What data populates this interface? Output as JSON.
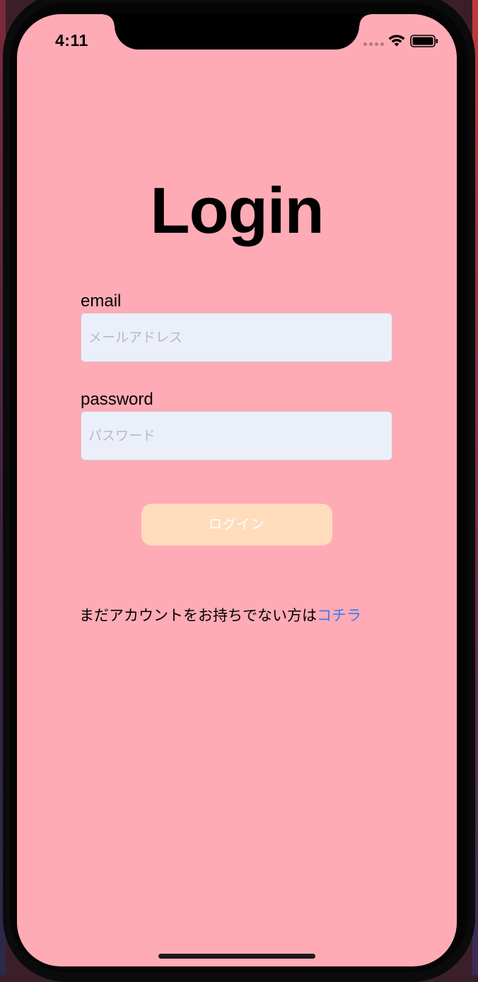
{
  "status_bar": {
    "time": "4:11"
  },
  "login": {
    "title": "Login",
    "email_label": "email",
    "email_placeholder": "メールアドレス",
    "email_value": "",
    "password_label": "password",
    "password_placeholder": "パスワード",
    "password_value": "",
    "button_label": "ログイン",
    "signup_prompt": "まだアカウントをお持ちでない方は",
    "signup_link": "コチラ"
  },
  "colors": {
    "background": "#ffabb5",
    "input_background": "#ebeff9",
    "button_background": "#ffdcbc",
    "link": "#3a7bf0"
  },
  "icons": {
    "signal": "cellular-signal-icon",
    "wifi": "wifi-icon",
    "battery": "battery-icon"
  }
}
